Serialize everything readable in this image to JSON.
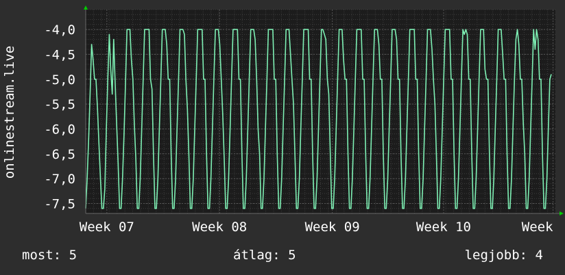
{
  "chart_data": {
    "type": "line",
    "ylabel": "onlinestream.live",
    "ylim": [
      -7.7,
      -3.6
    ],
    "yticks": [
      -4.0,
      -4.5,
      -5.0,
      -5.5,
      -6.0,
      -6.5,
      -7.0,
      -7.5
    ],
    "ytick_labels": [
      "-4,0",
      "-4,5",
      "-5,0",
      "-5,5",
      "-6,0",
      "-6,5",
      "-7,0",
      "-7,5"
    ],
    "xticks": [
      {
        "label": "Week 07",
        "at": 0.045
      },
      {
        "label": "Week 08",
        "at": 0.285
      },
      {
        "label": "Week 09",
        "at": 0.525
      },
      {
        "label": "Week 10",
        "at": 0.762
      },
      {
        "label": "Week",
        "at": 0.995
      }
    ],
    "grid": true,
    "series_color": "#7ef0b4",
    "cycle_values": [
      -7.6,
      -7.0,
      -6.0,
      -5.0,
      -4.0,
      -4.0,
      -4.0,
      -4.2,
      -5.0,
      -5.1,
      -6.5,
      -7.6
    ],
    "series": [
      {
        "values": [
          -7.6,
          -7.0,
          -6.2,
          -5.3,
          -4.3,
          -4.6,
          -5.0,
          -5.0,
          -5.6,
          -6.3,
          -7.0,
          -7.6,
          -7.6,
          -7.2,
          -6.0,
          -5.0,
          -4.1,
          -4.8,
          -5.3,
          -4.2,
          -5.1,
          -5.9,
          -6.7,
          -7.6,
          -7.6,
          -7.0,
          -6.1,
          -5.1,
          -4.0,
          -4.0,
          -4.0,
          -4.6,
          -5.0,
          -5.9,
          -6.6,
          -7.6,
          -7.6,
          -7.0,
          -6.0,
          -5.0,
          -4.0,
          -4.0,
          -4.0,
          -4.0,
          -5.0,
          -5.2,
          -6.5,
          -7.6,
          -7.6,
          -7.0,
          -6.0,
          -5.0,
          -4.0,
          -4.0,
          -4.0,
          -4.3,
          -5.0,
          -5.0,
          -6.5,
          -7.6,
          -7.6,
          -7.0,
          -6.0,
          -5.0,
          -4.0,
          -4.0,
          -4.0,
          -4.1,
          -5.0,
          -5.6,
          -6.5,
          -7.6,
          -7.6,
          -7.0,
          -6.0,
          -5.0,
          -4.0,
          -4.0,
          -4.0,
          -4.0,
          -5.0,
          -5.0,
          -6.5,
          -7.6,
          -7.6,
          -7.0,
          -6.0,
          -5.0,
          -4.0,
          -4.0,
          -4.0,
          -4.3,
          -5.0,
          -5.7,
          -6.6,
          -7.6,
          -7.6,
          -7.0,
          -6.0,
          -5.0,
          -4.0,
          -4.0,
          -4.0,
          -4.0,
          -5.0,
          -5.0,
          -6.5,
          -7.6,
          -7.6,
          -7.0,
          -6.0,
          -5.0,
          -4.0,
          -4.0,
          -4.0,
          -4.2,
          -5.0,
          -6.0,
          -6.5,
          -7.6,
          -7.6,
          -7.0,
          -6.0,
          -5.0,
          -4.0,
          -4.0,
          -4.0,
          -4.0,
          -5.0,
          -5.0,
          -6.5,
          -7.6,
          -7.6,
          -7.0,
          -6.0,
          -5.0,
          -4.0,
          -4.0,
          -4.0,
          -4.5,
          -5.0,
          -5.5,
          -6.5,
          -7.6,
          -7.6,
          -7.0,
          -6.0,
          -5.0,
          -4.0,
          -4.0,
          -4.0,
          -4.0,
          -5.0,
          -5.0,
          -6.5,
          -7.6,
          -7.6,
          -7.0,
          -6.0,
          -5.0,
          -4.0,
          -4.0,
          -4.1,
          -4.2,
          -5.0,
          -5.3,
          -6.5,
          -7.6,
          -7.6,
          -7.0,
          -6.0,
          -5.0,
          -4.0,
          -4.0,
          -4.0,
          -4.6,
          -5.0,
          -5.0,
          -6.5,
          -7.6,
          -7.6,
          -7.0,
          -6.0,
          -5.0,
          -4.0,
          -4.0,
          -4.0,
          -4.0,
          -5.0,
          -5.0,
          -6.5,
          -7.6,
          -7.6,
          -7.0,
          -6.0,
          -5.0,
          -4.0,
          -4.0,
          -4.0,
          -4.3,
          -5.0,
          -5.0,
          -6.5,
          -7.6,
          -7.6,
          -7.0,
          -6.0,
          -5.0,
          -4.0,
          -4.0,
          -4.0,
          -4.2,
          -5.0,
          -5.0,
          -6.5,
          -7.6,
          -7.6,
          -7.0,
          -6.0,
          -5.0,
          -4.0,
          -4.0,
          -4.0,
          -4.0,
          -5.0,
          -5.0,
          -6.5,
          -7.6,
          -7.6,
          -7.0,
          -6.0,
          -5.0,
          -4.0,
          -4.0,
          -4.0,
          -4.4,
          -5.0,
          -5.5,
          -6.5,
          -7.6,
          -7.6,
          -7.0,
          -6.0,
          -5.0,
          -4.0,
          -4.0,
          -4.0,
          -4.0,
          -5.0,
          -5.0,
          -6.5,
          -7.6,
          -7.6,
          -7.0,
          -6.0,
          -5.0,
          -4.0,
          -4.1,
          -4.0,
          -4.1,
          -5.0,
          -5.0,
          -6.5,
          -7.6,
          -7.6,
          -7.0,
          -6.0,
          -5.0,
          -4.0,
          -4.0,
          -4.0,
          -4.8,
          -5.0,
          -5.0,
          -6.5,
          -7.6,
          -7.6,
          -7.0,
          -6.0,
          -5.0,
          -4.0,
          -4.0,
          -4.0,
          -4.5,
          -5.0,
          -5.0,
          -6.5,
          -7.6,
          -7.6,
          -7.0,
          -6.0,
          -5.0,
          -4.2,
          -4.0,
          -4.3,
          -5.0,
          -5.0,
          -5.9,
          -6.5,
          -7.6,
          -7.6,
          -7.0,
          -6.0,
          -5.0,
          -4.0,
          -4.4,
          -4.0,
          -4.2,
          -5.0,
          -5.0,
          -6.5,
          -7.6,
          -7.6,
          -7.0,
          -6.0,
          -5.0,
          -4.9
        ]
      }
    ]
  },
  "footer": {
    "current": "most: 5",
    "average": "átlag: 5",
    "best": "legjobb: 4"
  }
}
